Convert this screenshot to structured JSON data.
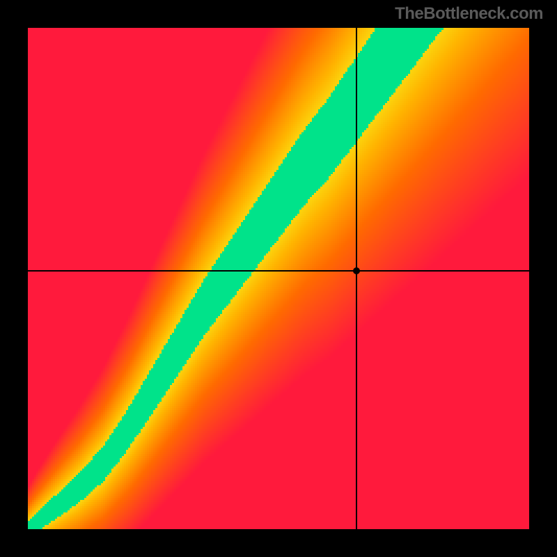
{
  "watermark": "TheBottleneck.com",
  "chart_data": {
    "type": "heatmap",
    "title": "",
    "xlabel": "",
    "ylabel": "",
    "xlim": [
      0,
      1
    ],
    "ylim": [
      0,
      1
    ],
    "crosshair": {
      "x": 0.655,
      "y": 0.515
    },
    "ridge_points": [
      {
        "x": 0.0,
        "y": 0.0
      },
      {
        "x": 0.05,
        "y": 0.04
      },
      {
        "x": 0.1,
        "y": 0.08
      },
      {
        "x": 0.15,
        "y": 0.13
      },
      {
        "x": 0.2,
        "y": 0.2
      },
      {
        "x": 0.25,
        "y": 0.28
      },
      {
        "x": 0.3,
        "y": 0.36
      },
      {
        "x": 0.35,
        "y": 0.44
      },
      {
        "x": 0.4,
        "y": 0.51
      },
      {
        "x": 0.45,
        "y": 0.58
      },
      {
        "x": 0.5,
        "y": 0.65
      },
      {
        "x": 0.55,
        "y": 0.72
      },
      {
        "x": 0.6,
        "y": 0.78
      },
      {
        "x": 0.65,
        "y": 0.85
      },
      {
        "x": 0.7,
        "y": 0.92
      },
      {
        "x": 0.75,
        "y": 0.99
      }
    ],
    "colors": {
      "optimal": "#00e38a",
      "near": "#f7f31a",
      "mid": "#ffb400",
      "far": "#ff6a00",
      "worst": "#ff1a3c"
    },
    "grid_resolution": 240
  }
}
